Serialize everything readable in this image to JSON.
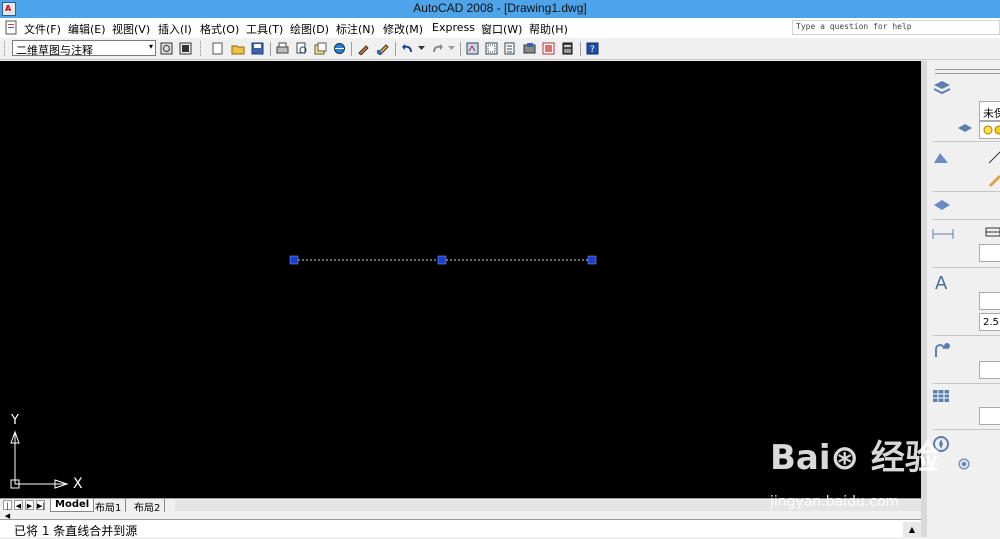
{
  "window": {
    "title": "AutoCAD 2008 - [Drawing1.dwg]",
    "app_icon_text": "A"
  },
  "menu": [
    {
      "label": "文件(F)"
    },
    {
      "label": "编辑(E)"
    },
    {
      "label": "视图(V)"
    },
    {
      "label": "插入(I)"
    },
    {
      "label": "格式(O)"
    },
    {
      "label": "工具(T)"
    },
    {
      "label": "绘图(D)"
    },
    {
      "label": "标注(N)"
    },
    {
      "label": "修改(M)"
    },
    {
      "label": "Express"
    },
    {
      "label": "窗口(W)"
    },
    {
      "label": "帮助(H)"
    }
  ],
  "help": {
    "placeholder": "Type a question for help"
  },
  "toolbar": {
    "workspace": "二维草图与注释",
    "dropdown_icon": "▾",
    "icons": [
      "workspace-settings-icon",
      "workspace-icon",
      "qnew-icon",
      "open-icon",
      "save-icon",
      "plot-icon",
      "plot-preview-icon",
      "publish-icon",
      "3d-dwf-icon",
      "match-properties-icon",
      "block-editor-icon",
      "undo-icon",
      "undo-dropdown-icon",
      "redo-icon",
      "redo-dropdown-icon",
      "pan-icon",
      "zoom-realtime-icon",
      "properties-icon",
      "design-center-icon",
      "tool-palettes-icon",
      "sheet-set-icon",
      "markup-icon",
      "quickcalc-icon",
      "help-icon"
    ]
  },
  "canvas": {
    "background": "#000000",
    "line_color": "#d8d8d8",
    "grip_color": "#1a3ecf",
    "ucs_x_label": "X",
    "ucs_y_label": "Y"
  },
  "right_panel": {
    "layer_state": "未保存",
    "text_height": "2.5"
  },
  "tabs": {
    "nav": [
      "|◀",
      "◀",
      "▶",
      "▶|"
    ],
    "items": [
      {
        "label": "Model"
      },
      {
        "label": "布局1"
      },
      {
        "label": "布局2"
      }
    ]
  },
  "command": {
    "text": "已将 1 条直线合并到源"
  },
  "watermark": {
    "logo": "Bai⊛ 经验",
    "url": "jingyan.baidu.com"
  }
}
